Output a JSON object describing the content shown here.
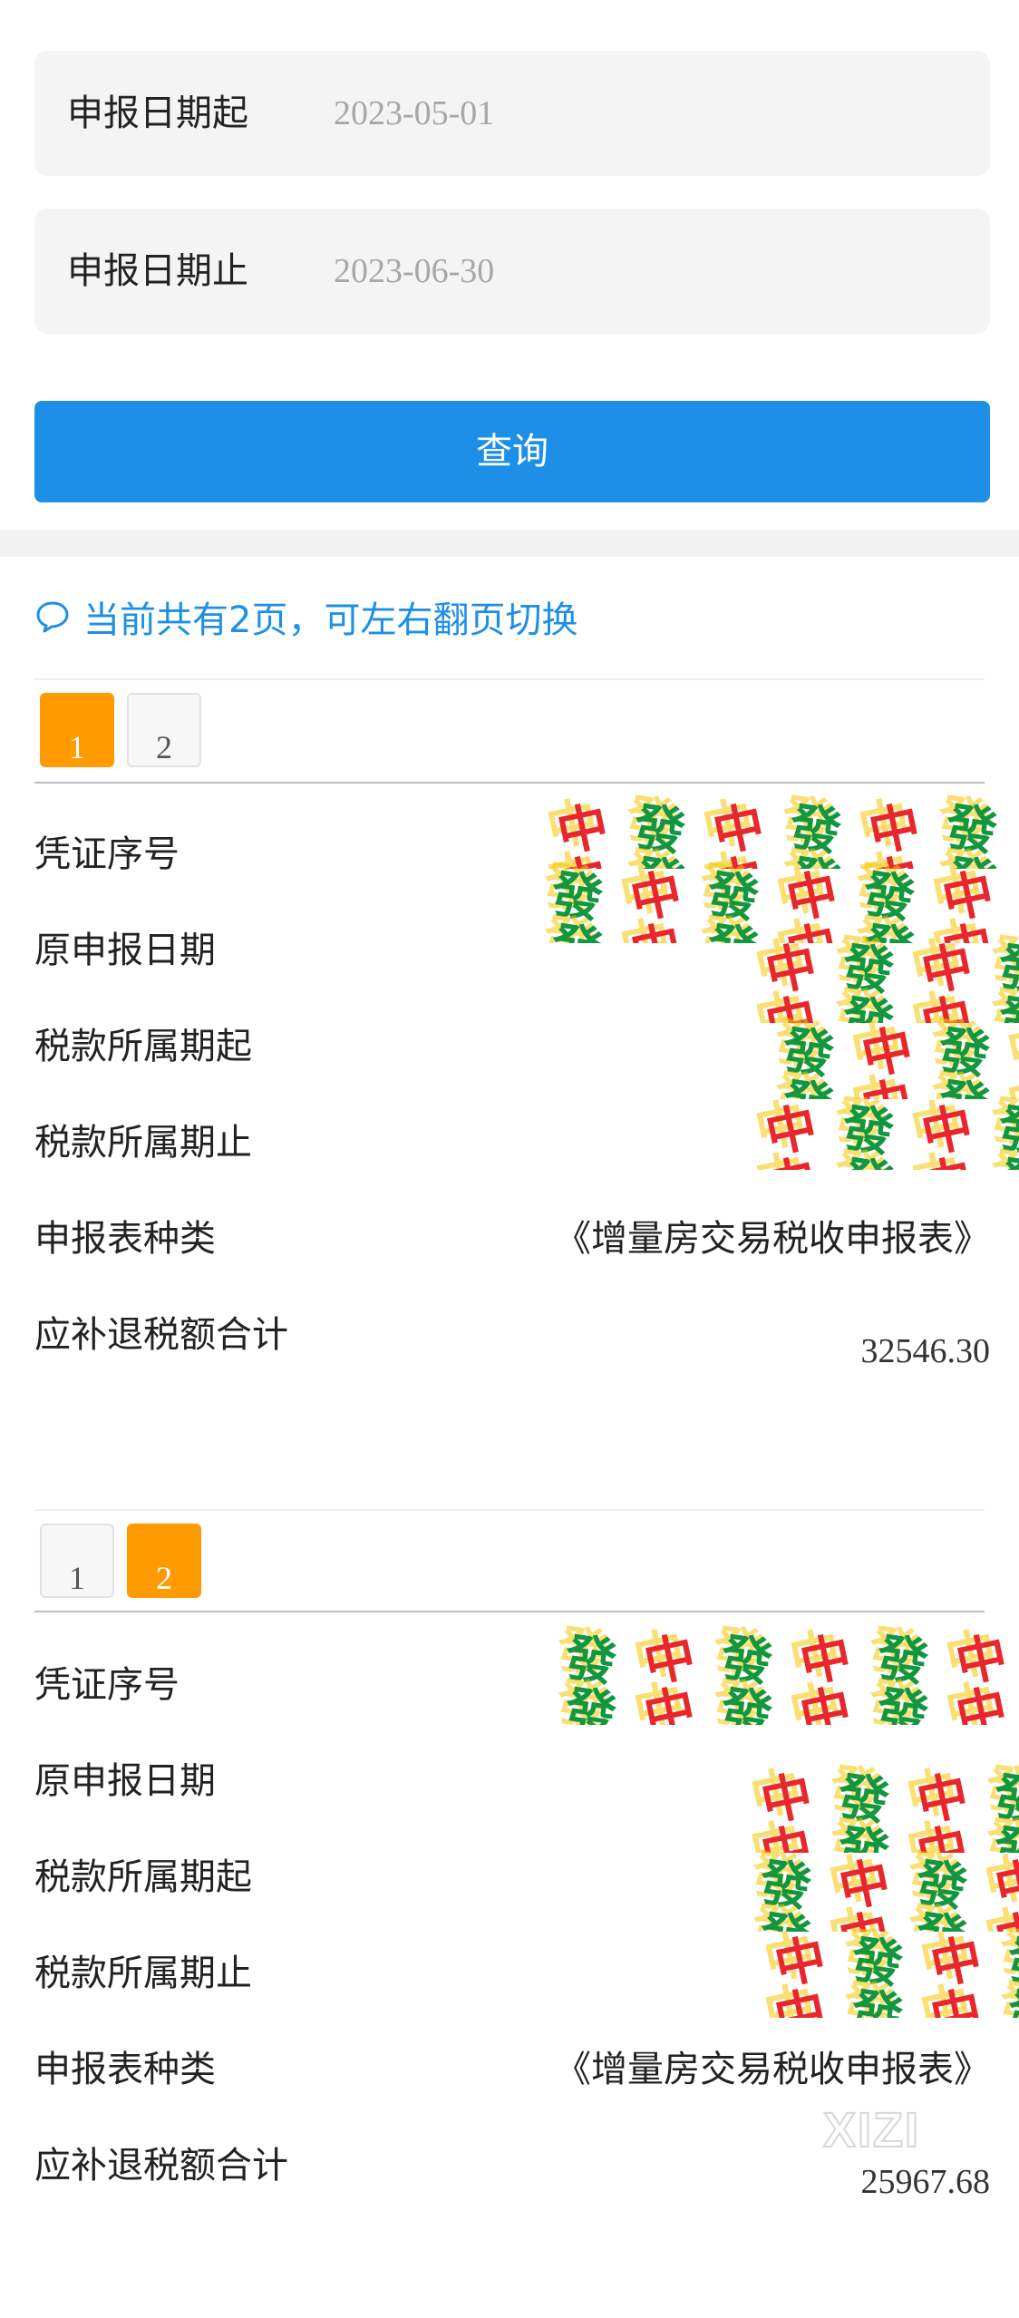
{
  "form": {
    "start": {
      "label": "申报日期起",
      "value": "2023-05-01"
    },
    "end": {
      "label": "申报日期止",
      "value": "2023-06-30"
    },
    "query_label": "查询"
  },
  "tip": {
    "text": "当前共有2页，可左右翻页切换"
  },
  "pager": [
    "1",
    "2"
  ],
  "records": [
    {
      "active_page": 1,
      "rows": [
        {
          "label": "凭证序号",
          "value": ""
        },
        {
          "label": "原申报日期",
          "value": ""
        },
        {
          "label": "税款所属期起",
          "value": ""
        },
        {
          "label": "税款所属期止",
          "value": ""
        },
        {
          "label": "申报表种类",
          "value": "《增量房交易税收申报表》"
        },
        {
          "label": "应补退税额合计",
          "value": "32546.30"
        }
      ]
    },
    {
      "active_page": 2,
      "rows": [
        {
          "label": "凭证序号",
          "value": ""
        },
        {
          "label": "原申报日期",
          "value": ""
        },
        {
          "label": "税款所属期起",
          "value": ""
        },
        {
          "label": "税款所属期止",
          "value": ""
        },
        {
          "label": "申报表种类",
          "value": "《增量房交易税收申报表》"
        },
        {
          "label": "应补退税额合计",
          "value": "25967.68"
        }
      ]
    }
  ],
  "mosaic_glyphs": [
    "中",
    "發"
  ],
  "watermark": "XIZI",
  "colors": {
    "accent": "#1e8fe6",
    "active_page": "#ff9a00",
    "mosaic_red": "#e8262b",
    "mosaic_green": "#12963f",
    "mosaic_yellow": "#f5c400"
  }
}
